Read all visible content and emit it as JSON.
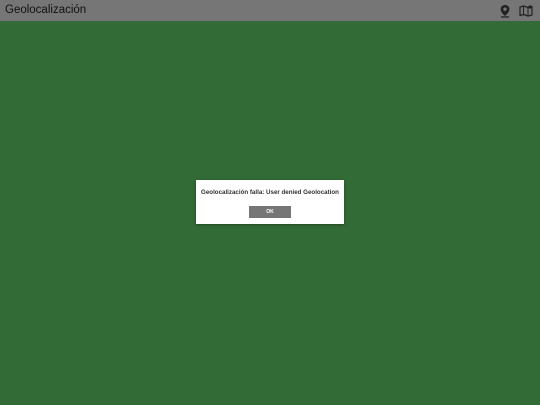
{
  "app": {
    "title": "Geolocalización",
    "background_color": "#336b37",
    "titlebar_color": "#767676"
  },
  "toolbar": {
    "icons": [
      {
        "name": "location-pin-icon"
      },
      {
        "name": "map-icon"
      }
    ]
  },
  "dialog": {
    "message": "Geolocalización falla: User denied Geolocation",
    "ok_label": "OK"
  }
}
